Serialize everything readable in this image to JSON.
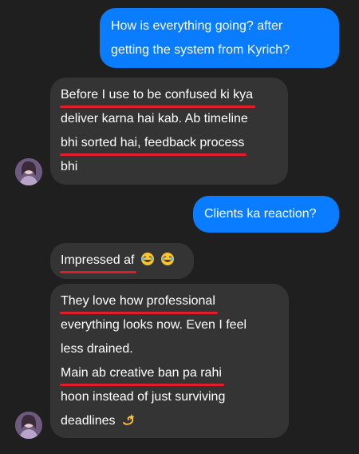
{
  "messages": [
    {
      "id": "m1",
      "direction": "outgoing",
      "lines": [
        "How is everything going? after",
        "getting the system from Kyrich?"
      ]
    },
    {
      "id": "m2",
      "direction": "incoming",
      "lines": [
        "Before I use to be confused ki kya",
        "deliver karna hai kab. Ab timeline",
        "bhi sorted hai, feedback process",
        "bhi"
      ]
    },
    {
      "id": "m3",
      "direction": "outgoing",
      "lines": [
        "Clients ka reaction?"
      ]
    },
    {
      "id": "m4",
      "direction": "incoming",
      "lines": [
        "Impressed af"
      ],
      "emojis": [
        "rolling-on-floor-laughing-emoji",
        "rolling-on-floor-laughing-emoji"
      ]
    },
    {
      "id": "m5",
      "direction": "incoming",
      "lines": [
        "They love how professional",
        "everything looks now. Even I feel",
        "less drained.",
        "Main ab creative ban pa rahi",
        "hoon instead of just surviving",
        "deadlines"
      ],
      "emojis": [
        "dizzy-emoji"
      ]
    }
  ],
  "colors": {
    "background": "#1f1f1f",
    "outgoing_bubble": "#0a7cff",
    "incoming_bubble": "#343434",
    "underline": "#e21d2a",
    "text": "#ffffff"
  }
}
